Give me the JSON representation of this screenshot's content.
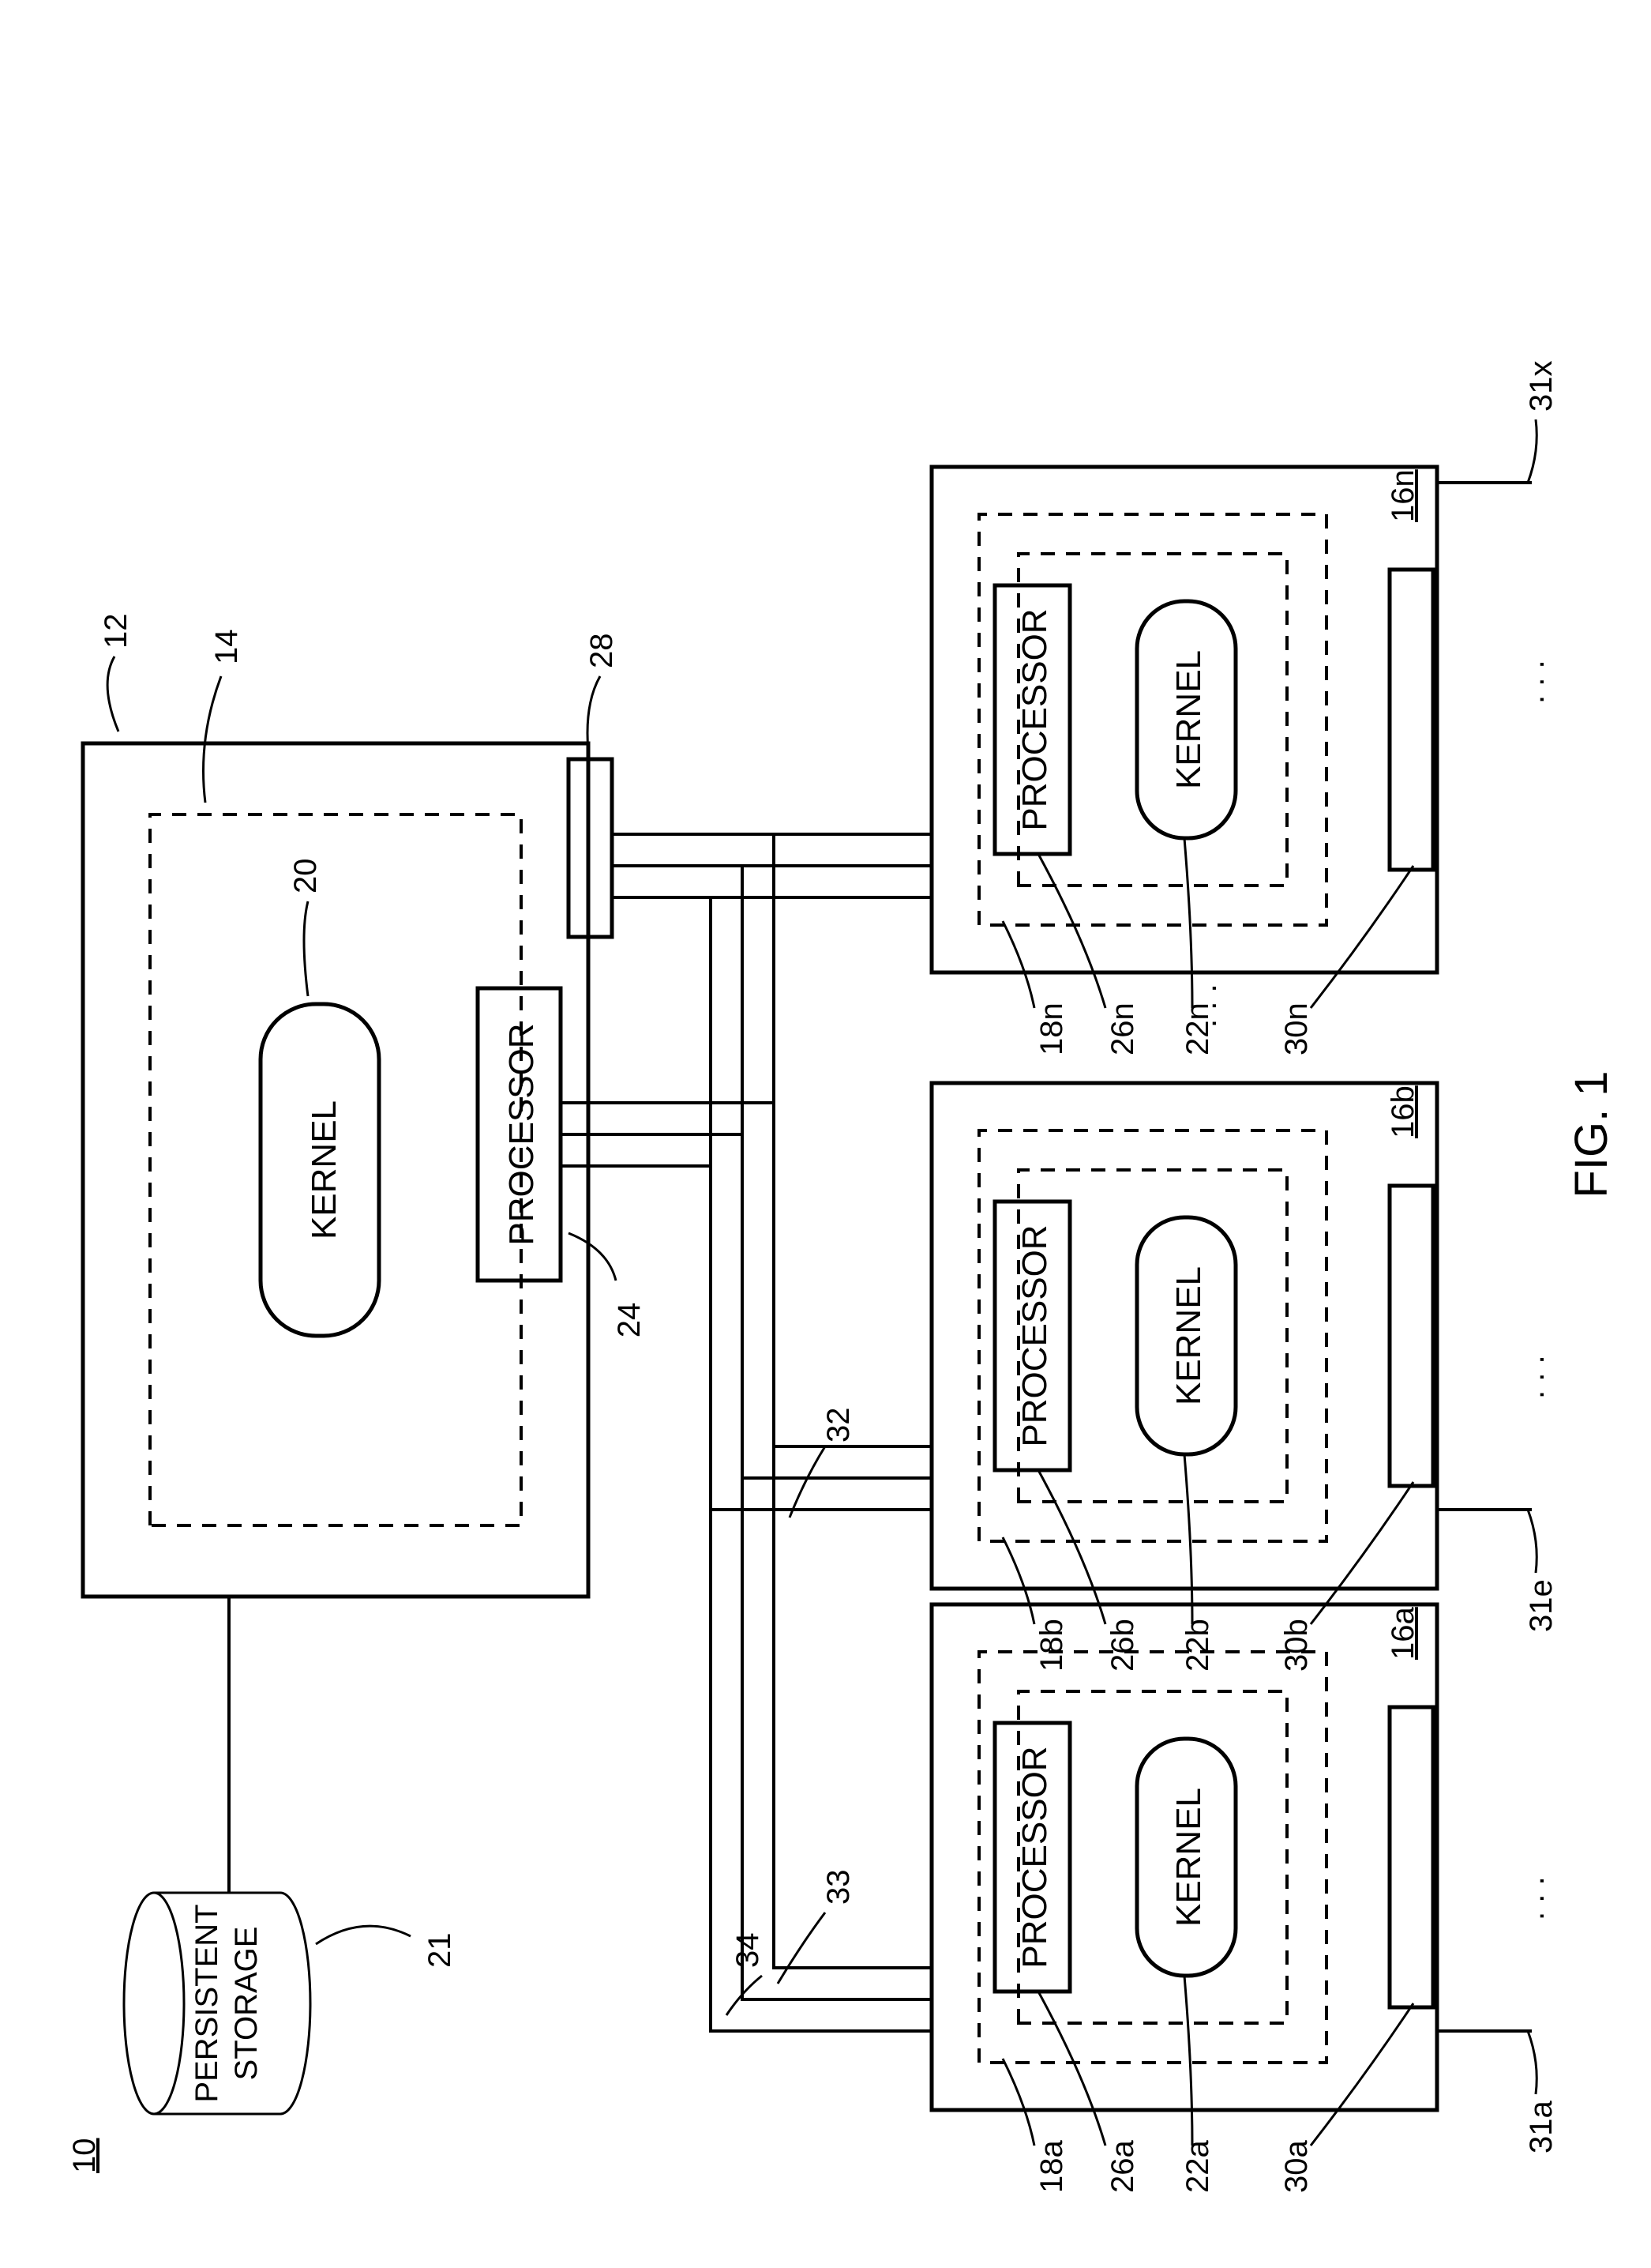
{
  "figure_ref": "10",
  "figure_caption": "FIG. 1",
  "components": {
    "persistent_storage": {
      "label_line1": "PERSISTENT",
      "label_line2": "STORAGE",
      "ref": "21"
    },
    "main": {
      "box_ref": "12",
      "innerbox_ref": "14",
      "kernel": {
        "label": "KERNEL",
        "ref": "20"
      },
      "processor": {
        "label": "PROCESSOR",
        "ref": "24",
        "slave_ref": "28"
      }
    },
    "buses": {
      "bus32": "32",
      "bus33": "33",
      "bus34": "34"
    },
    "client_unit_label": {
      "a": "16a",
      "b": "16b",
      "n": "16n"
    },
    "client": {
      "a": {
        "dash_ref": "18a",
        "proc_ref": "26a",
        "kernel_ref": "22a",
        "slot_ref": "30a",
        "port_ref": "31a"
      },
      "b": {
        "dash_ref": "18b",
        "proc_ref": "26b",
        "kernel_ref": "22b",
        "slot_ref": "30b",
        "port_ref": "31e"
      },
      "n": {
        "dash_ref": "18n",
        "proc_ref": "26n",
        "kernel_ref": "22n",
        "slot_ref": "30n",
        "port_ref": "31x"
      }
    },
    "generic_labels": {
      "processor": "PROCESSOR",
      "kernel": "KERNEL"
    },
    "ellipsis": ". . ."
  }
}
